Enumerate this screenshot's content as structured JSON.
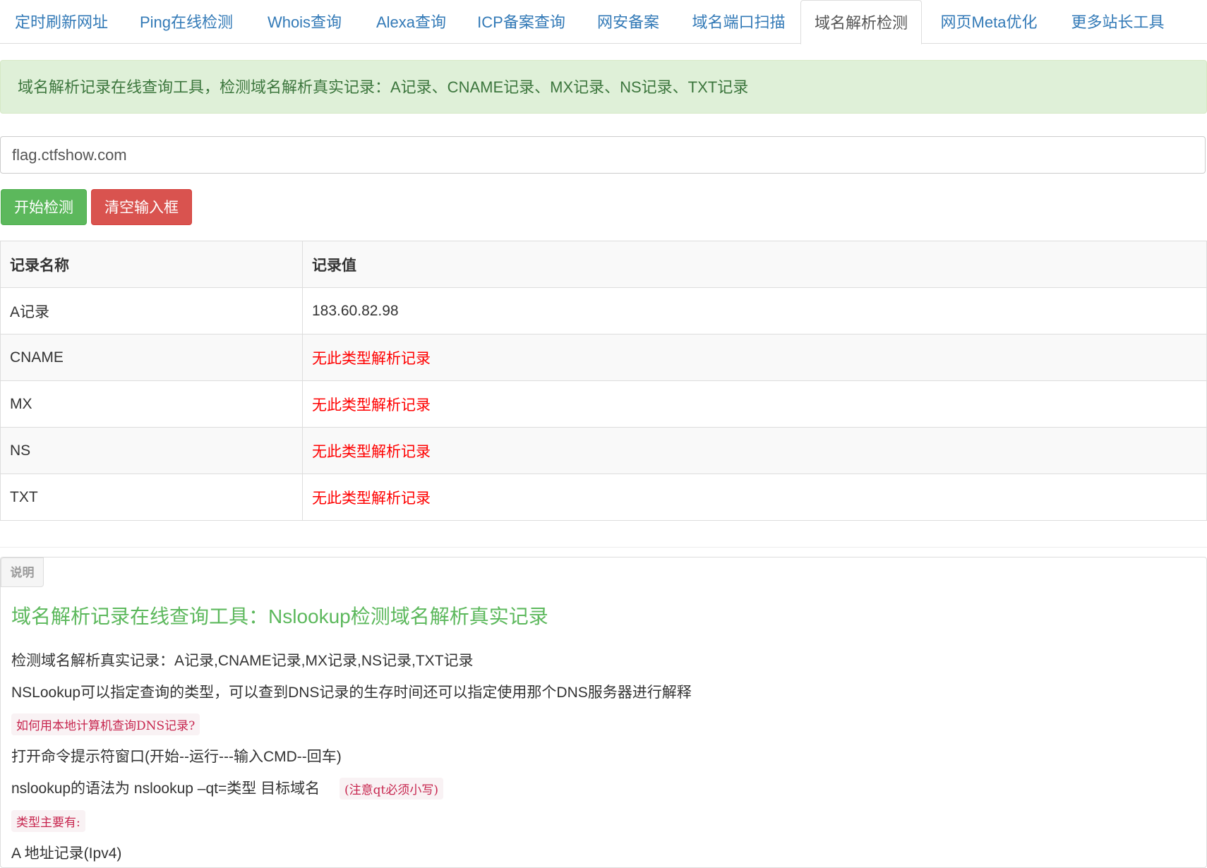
{
  "nav": {
    "tabs": [
      {
        "label": "定时刷新网址"
      },
      {
        "label": "Ping在线检测"
      },
      {
        "label": "Whois查询"
      },
      {
        "label": "Alexa查询"
      },
      {
        "label": "ICP备案查询"
      },
      {
        "label": "网安备案"
      },
      {
        "label": "域名端口扫描"
      },
      {
        "label": "域名解析检测",
        "active": true
      },
      {
        "label": "网页Meta优化"
      },
      {
        "label": "更多站长工具"
      }
    ]
  },
  "alert": {
    "text": "域名解析记录在线查询工具，检测域名解析真实记录：A记录、CNAME记录、MX记录、NS记录、TXT记录"
  },
  "domain_input": {
    "value": "flag.ctfshow.com"
  },
  "buttons": {
    "start": "开始检测",
    "clear": "清空输入框"
  },
  "table": {
    "headers": [
      "记录名称",
      "记录值"
    ],
    "rows": [
      {
        "name": "A记录",
        "value": "183.60.82.98"
      },
      {
        "name": "CNAME",
        "value": "无此类型解析记录"
      },
      {
        "name": "MX",
        "value": "无此类型解析记录"
      },
      {
        "name": "NS",
        "value": "无此类型解析记录"
      },
      {
        "name": "TXT",
        "value": "无此类型解析记录"
      }
    ]
  },
  "description": {
    "badge": "说明",
    "title": "域名解析记录在线查询工具：Nslookup检测域名解析真实记录",
    "line1": "检测域名解析真实记录：A记录,CNAME记录,MX记录,NS记录,TXT记录",
    "line2": "NSLookup可以指定查询的类型，可以查到DNS记录的生存时间还可以指定使用那个DNS服务器进行解释",
    "code1": "如何用本地计算机查询DNS记录?",
    "line3": "打开命令提示符窗口(开始--运行---输入CMD--回车)",
    "line4": "nslookup的语法为 nslookup –qt=类型 目标域名",
    "code2": "(注意qt必须小写)",
    "code3": "类型主要有:",
    "line5": "A 地址记录(Ipv4)"
  },
  "colors": {
    "link": "#337ab7",
    "success": "#5cb85c",
    "danger": "#d9534f",
    "error_text": "#ff0000",
    "alert_bg": "#dff0d8"
  }
}
